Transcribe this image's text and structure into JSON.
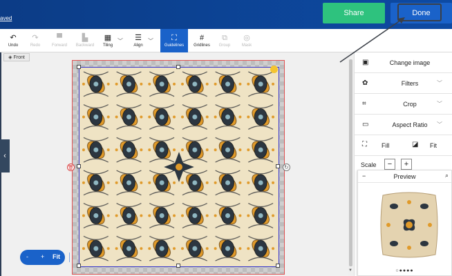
{
  "header": {
    "saved_text": "aved",
    "share_label": "Share",
    "done_label": "Done"
  },
  "toolbar": {
    "undo": "Undo",
    "redo": "Redo",
    "forward": "Forward",
    "backward": "Backward",
    "tiling": "Tiling",
    "align": "Align",
    "guidelines": "Guidelines",
    "gridlines": "Gridlines",
    "group": "Group",
    "mask": "Mask"
  },
  "canvas": {
    "side_tab": "Front"
  },
  "zoom": {
    "minus": "-",
    "plus": "+",
    "fit": "Fit"
  },
  "panel": {
    "change_image": "Change image",
    "filters": "Filters",
    "crop": "Crop",
    "aspect_ratio": "Aspect Ratio",
    "fill": "Fill",
    "fit": "Fit",
    "scale": "Scale",
    "scale_minus": "−",
    "scale_plus": "+"
  },
  "preview": {
    "collapse": "−",
    "title": "Preview",
    "dots": "○●●●●"
  },
  "colors": {
    "header": "#0d4aa3",
    "share": "#2ec27e",
    "done": "#1a62c9",
    "pattern_bg": "#efe3c4",
    "pattern_dark": "#2c3640",
    "pattern_accent": "#e09a2a"
  }
}
